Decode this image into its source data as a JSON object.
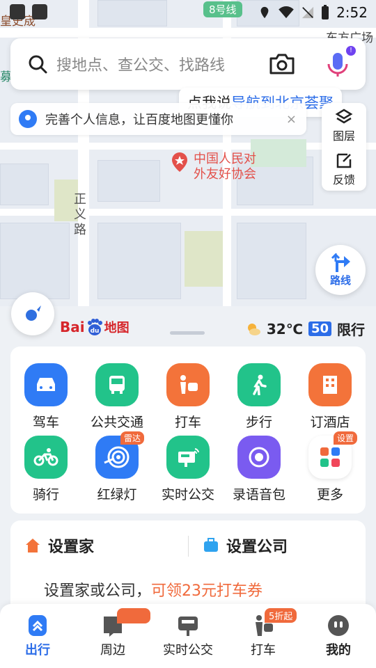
{
  "status_bar": {
    "line_badge": "8号线",
    "time": "2:52"
  },
  "map": {
    "top_left_label": "皇史宬",
    "top_right_label": "东方广场",
    "left_edge_label": "募",
    "street_name": "正义路",
    "poi": "中国人民对外友好协会",
    "route_label": "路线"
  },
  "search": {
    "placeholder": "搜地点、查公交、找路线",
    "mic_dot": "!"
  },
  "voice_tip": {
    "prefix": "点我说",
    "highlight": "导航到北京荟聚"
  },
  "notice": {
    "text": "完善个人信息，让百度地图更懂你",
    "close": "×"
  },
  "side_tools": {
    "layers": "图层",
    "feedback": "反馈"
  },
  "logo": {
    "bai": "Bai",
    "du": "du",
    "ditu": "地图"
  },
  "weather": {
    "temp": "32℃",
    "plate": "50",
    "restriction": "限行"
  },
  "features": [
    {
      "label": "驾车",
      "icon": "car-icon",
      "color": "#2f7bf5"
    },
    {
      "label": "公共交通",
      "icon": "bus-icon",
      "color": "#22c38a"
    },
    {
      "label": "打车",
      "icon": "taxi-icon",
      "color": "#f3733a"
    },
    {
      "label": "步行",
      "icon": "walk-icon",
      "color": "#22c38a"
    },
    {
      "label": "订酒店",
      "icon": "hotel-icon",
      "color": "#f3733a"
    },
    {
      "label": "骑行",
      "icon": "bike-icon",
      "color": "#22c38a"
    },
    {
      "label": "红绿灯",
      "icon": "traffic-light-icon",
      "color": "#2f7bf5",
      "badge": "雷达"
    },
    {
      "label": "实时公交",
      "icon": "realtime-bus-icon",
      "color": "#22c38a"
    },
    {
      "label": "录语音包",
      "icon": "voice-pack-icon",
      "color": "#7a5bf0"
    },
    {
      "label": "更多",
      "icon": "more-icon",
      "color": "#ffffff",
      "badge": "设置"
    }
  ],
  "home_company": {
    "home": "设置家",
    "company": "设置公司",
    "promo_prefix": "设置家或公司，",
    "promo_highlight": "可领23元打车券"
  },
  "bottom_nav": [
    {
      "label": "出行",
      "active": true
    },
    {
      "label": "周边"
    },
    {
      "label": "实时公交"
    },
    {
      "label": "打车",
      "badge": "5折起"
    },
    {
      "label": "我的"
    }
  ]
}
